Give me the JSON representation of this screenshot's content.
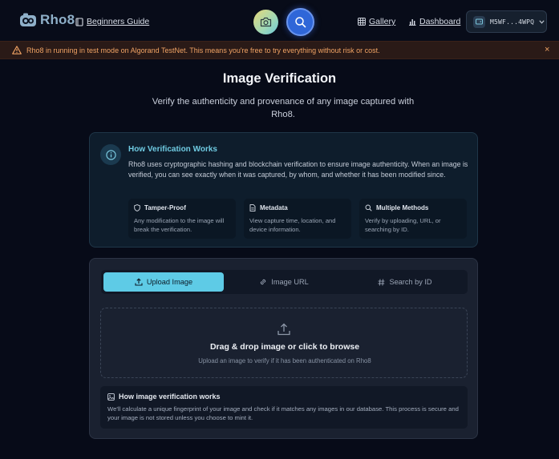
{
  "header": {
    "brand": "Rho8",
    "guide_label": "Beginners Guide",
    "gallery_label": "Gallery",
    "dashboard_label": "Dashboard",
    "wallet_address": "M5WF...4WPQ"
  },
  "banner": {
    "text": "Rho8 in running in test mode on Algorand TestNet. This means you're free to try everything without risk or cost.",
    "close": "×"
  },
  "page": {
    "title": "Image Verification",
    "subtitle": "Verify the authenticity and provenance of any image captured with Rho8."
  },
  "how": {
    "title": "How Verification Works",
    "description": "Rho8 uses cryptographic hashing and blockchain verification to ensure image authenticity. When an image is verified, you can see exactly when it was captured, by whom, and whether it has been modified since.",
    "features": [
      {
        "title": "Tamper-Proof",
        "description": "Any modification to the image will break the verification.",
        "icon": "shield-icon"
      },
      {
        "title": "Metadata",
        "description": "View capture time, location, and device information.",
        "icon": "file-icon"
      },
      {
        "title": "Multiple Methods",
        "description": "Verify by uploading, URL, or searching by ID.",
        "icon": "search-icon"
      }
    ]
  },
  "tabs": [
    {
      "label": "Upload Image",
      "active": true
    },
    {
      "label": "Image URL",
      "active": false
    },
    {
      "label": "Search by ID",
      "active": false
    }
  ],
  "dropzone": {
    "title": "Drag & drop image or click to browse",
    "subtitle": "Upload an image to verify if it has been authenticated on Rho8"
  },
  "info": {
    "title": "How image verification works",
    "description": "We'll calculate a unique fingerprint of your image and check if it matches any images in our database. This process is secure and your image is not stored unless you choose to mint it."
  },
  "colors": {
    "accent": "#5ecbe6",
    "warning": "#f0a364",
    "background": "#070b18"
  }
}
